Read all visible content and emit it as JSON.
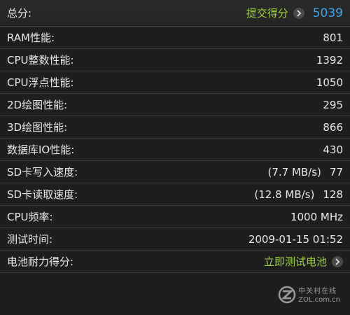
{
  "header": {
    "label": "总分:",
    "submit_label": "提交得分",
    "score": "5039"
  },
  "rows": [
    {
      "label": "RAM性能:",
      "value": "801"
    },
    {
      "label": "CPU整数性能:",
      "value": "1392"
    },
    {
      "label": "CPU浮点性能:",
      "value": "1050"
    },
    {
      "label": "2D绘图性能:",
      "value": "295"
    },
    {
      "label": "3D绘图性能:",
      "value": "866"
    },
    {
      "label": "数据库IO性能:",
      "value": "430"
    },
    {
      "label": "SD卡写入速度:",
      "speed": "(7.7 MB/s)",
      "value": "77"
    },
    {
      "label": "SD卡读取速度:",
      "speed": "(12.8 MB/s)",
      "value": "128"
    },
    {
      "label": "CPU频率:",
      "value": "1000 MHz"
    },
    {
      "label": "测试时间:",
      "value": "2009-01-15 01:52"
    }
  ],
  "battery": {
    "label": "电池耐力得分:",
    "action_label": "立即测试电池"
  },
  "watermark": {
    "brand_cn": "中关村在线",
    "url": "ZOL.com.cn"
  },
  "colors": {
    "background": "#1e1e1e",
    "link_green": "#9ed23a",
    "score_blue": "#3aa6ee"
  },
  "icons": {
    "submit_arrow": "chevron-right-icon",
    "battery_arrow": "chevron-right-icon",
    "watermark_logo": "zol-logo-icon"
  }
}
